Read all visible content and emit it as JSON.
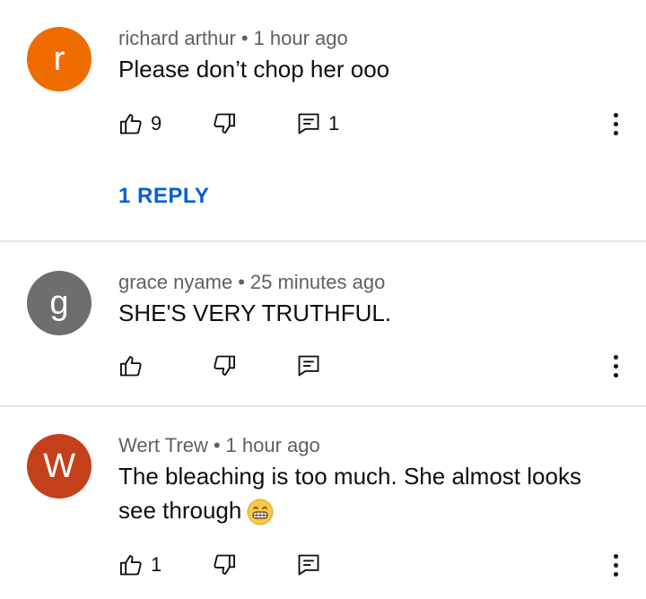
{
  "comments": [
    {
      "avatar_letter": "r",
      "avatar_color": "#ef6c00",
      "author": "richard arthur",
      "time": "1 hour ago",
      "text": "Please don’t chop her ooo",
      "likes": "9",
      "replies": "1",
      "reply_link": "1 REPLY"
    },
    {
      "avatar_letter": "g",
      "avatar_color": "#6e6e6e",
      "author": "grace nyame",
      "time": "25 minutes ago",
      "text": "SHE'S VERY TRUTHFUL."
    },
    {
      "avatar_letter": "W",
      "avatar_color": "#c4401a",
      "author": "Wert Trew",
      "time": "1 hour ago",
      "text": "The bleaching is too much. She almost looks see through",
      "emoji": "grinning-face-icon",
      "likes": "1"
    }
  ],
  "separator": "•"
}
